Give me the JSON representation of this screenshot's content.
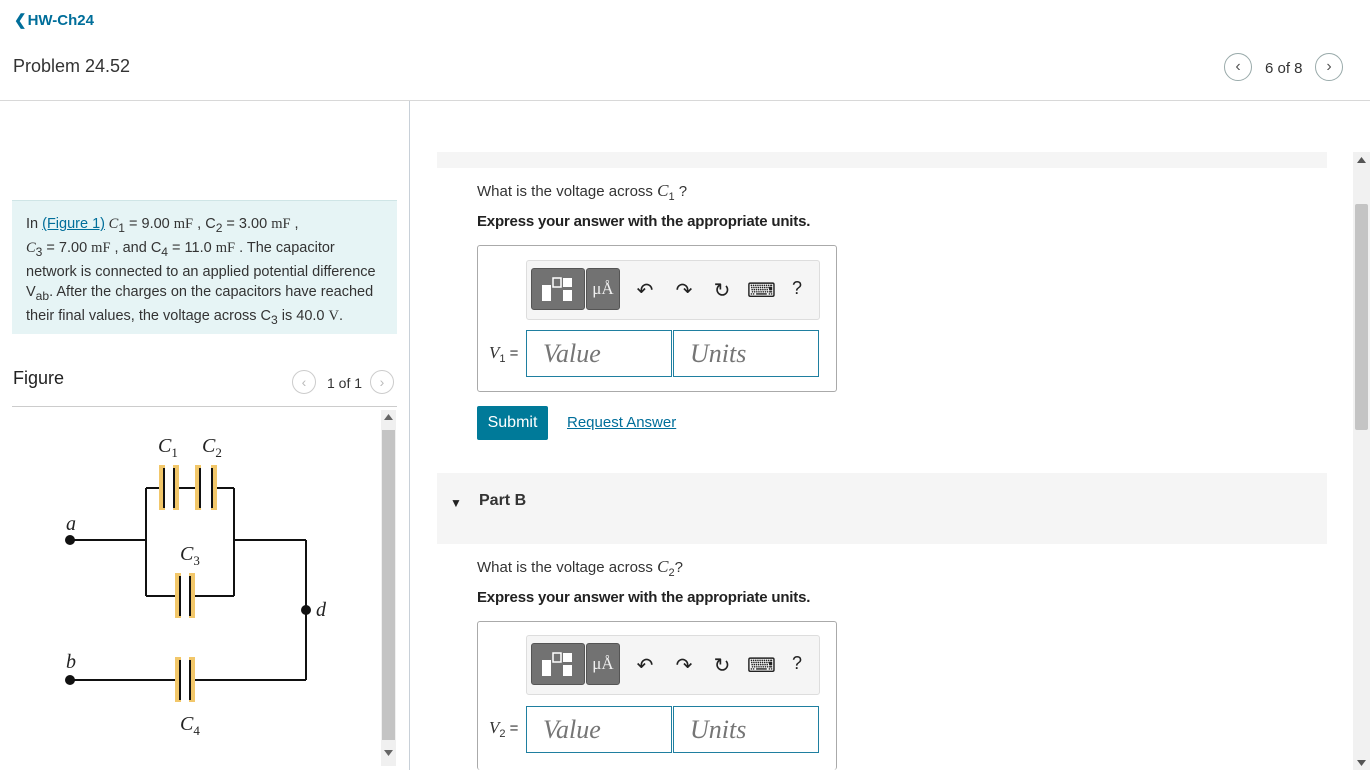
{
  "header": {
    "back_chevron": "❮",
    "back_label": "HW-Ch24",
    "problem_title": "Problem 24.52",
    "pager": "6 of 8",
    "prev_icon": "‹",
    "next_icon": "›"
  },
  "intro": {
    "t1": "In ",
    "figure_link": "(Figure 1)",
    "t2": " C",
    "t3": "1",
    "t4": " = 9.00 ",
    "t5": "mF",
    "t6": " , C",
    "t7": "2",
    "t8": " = 3.00 ",
    "t9": "mF",
    "t10": " ,",
    "t11": "C",
    "t12": "3",
    "t13": " = 7.00 ",
    "t14": "mF",
    "t15": " , and C",
    "t16": "4",
    "t17": " = 11.0 ",
    "t18": "mF",
    "t19": " . The capacitor network is connected to an applied potential difference V",
    "t20": "ab",
    "t21": ". After the charges on the capacitors have reached their final values, the voltage across C",
    "t22": "3",
    "t23": " is 40.0 ",
    "t24": "V",
    "t25": "."
  },
  "figure": {
    "label": "Figure",
    "pager": "1 of 1",
    "labels": {
      "c1": "C",
      "c1_sub": "1",
      "c2": "C",
      "c2_sub": "2",
      "c3": "C",
      "c3_sub": "3",
      "c4": "C",
      "c4_sub": "4",
      "a": "a",
      "b": "b",
      "d": "d"
    },
    "colors": {
      "plate": "#f2c76a",
      "wire": "#111111"
    }
  },
  "partA": {
    "question_prefix": "What is the voltage across ",
    "question_var": "C",
    "question_sub": "1",
    "question_suffix": " ?",
    "instruction": "Express your answer with the appropriate units.",
    "var_label": "V",
    "var_sub": "1",
    "var_eq": " =",
    "value_placeholder": "Value",
    "units_placeholder": "Units",
    "submit": "Submit",
    "request": "Request Answer"
  },
  "partB": {
    "label": "Part B",
    "question_prefix": "What is the voltage across ",
    "question_var": "C",
    "question_sub": "2",
    "question_suffix": "?",
    "instruction": "Express your answer with the appropriate units.",
    "var_label": "V",
    "var_sub": "2",
    "var_eq": " =",
    "value_placeholder": "Value",
    "units_placeholder": "Units"
  },
  "toolbar": {
    "mu_label": "μÅ",
    "undo": "↶",
    "redo": "↷",
    "reset": "↻",
    "keyboard": "⌨",
    "help": "?"
  },
  "colors": {
    "accent": "#007a99",
    "link": "#006e9a",
    "intro_bg": "#e6f4f5"
  }
}
